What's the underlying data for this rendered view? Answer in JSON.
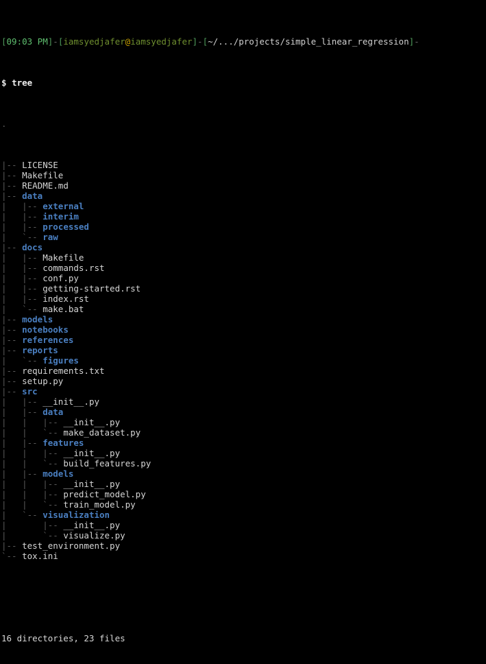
{
  "terminal": {
    "prompt": {
      "open_bracket": "[",
      "time": "09:03 PM",
      "close_bracket": "]",
      "dash1": "-",
      "user_open": "[",
      "user": "iamsyedjafer",
      "at": "@",
      "host": "iamsyedjafer",
      "user_close": "]",
      "dash2": "-",
      "path_open": "[",
      "path": "~/.../projects/simple_linear_regression",
      "path_close": "]",
      "dash3": "-",
      "dollar": "$",
      "command": "tree"
    },
    "tree": {
      "root": ".",
      "entries": [
        {
          "connector": "|-- ",
          "name": "LICENSE",
          "type": "file"
        },
        {
          "connector": "|-- ",
          "name": "Makefile",
          "type": "file"
        },
        {
          "connector": "|-- ",
          "name": "README.md",
          "type": "file"
        },
        {
          "connector": "|-- ",
          "name": "data",
          "type": "dir"
        },
        {
          "connector": "|   |-- ",
          "name": "external",
          "type": "dir"
        },
        {
          "connector": "|   |-- ",
          "name": "interim",
          "type": "dir"
        },
        {
          "connector": "|   |-- ",
          "name": "processed",
          "type": "dir"
        },
        {
          "connector": "|   `-- ",
          "name": "raw",
          "type": "dir"
        },
        {
          "connector": "|-- ",
          "name": "docs",
          "type": "dir"
        },
        {
          "connector": "|   |-- ",
          "name": "Makefile",
          "type": "file"
        },
        {
          "connector": "|   |-- ",
          "name": "commands.rst",
          "type": "file"
        },
        {
          "connector": "|   |-- ",
          "name": "conf.py",
          "type": "file"
        },
        {
          "connector": "|   |-- ",
          "name": "getting-started.rst",
          "type": "file"
        },
        {
          "connector": "|   |-- ",
          "name": "index.rst",
          "type": "file"
        },
        {
          "connector": "|   `-- ",
          "name": "make.bat",
          "type": "file"
        },
        {
          "connector": "|-- ",
          "name": "models",
          "type": "dir"
        },
        {
          "connector": "|-- ",
          "name": "notebooks",
          "type": "dir"
        },
        {
          "connector": "|-- ",
          "name": "references",
          "type": "dir"
        },
        {
          "connector": "|-- ",
          "name": "reports",
          "type": "dir"
        },
        {
          "connector": "|   `-- ",
          "name": "figures",
          "type": "dir"
        },
        {
          "connector": "|-- ",
          "name": "requirements.txt",
          "type": "file"
        },
        {
          "connector": "|-- ",
          "name": "setup.py",
          "type": "file"
        },
        {
          "connector": "|-- ",
          "name": "src",
          "type": "dir"
        },
        {
          "connector": "|   |-- ",
          "name": "__init__.py",
          "type": "file"
        },
        {
          "connector": "|   |-- ",
          "name": "data",
          "type": "dir"
        },
        {
          "connector": "|   |   |-- ",
          "name": "__init__.py",
          "type": "file"
        },
        {
          "connector": "|   |   `-- ",
          "name": "make_dataset.py",
          "type": "file"
        },
        {
          "connector": "|   |-- ",
          "name": "features",
          "type": "dir"
        },
        {
          "connector": "|   |   |-- ",
          "name": "__init__.py",
          "type": "file"
        },
        {
          "connector": "|   |   `-- ",
          "name": "build_features.py",
          "type": "file"
        },
        {
          "connector": "|   |-- ",
          "name": "models",
          "type": "dir"
        },
        {
          "connector": "|   |   |-- ",
          "name": "__init__.py",
          "type": "file"
        },
        {
          "connector": "|   |   |-- ",
          "name": "predict_model.py",
          "type": "file"
        },
        {
          "connector": "|   |   `-- ",
          "name": "train_model.py",
          "type": "file"
        },
        {
          "connector": "|   `-- ",
          "name": "visualization",
          "type": "dir"
        },
        {
          "connector": "|       |-- ",
          "name": "__init__.py",
          "type": "file"
        },
        {
          "connector": "|       `-- ",
          "name": "visualize.py",
          "type": "file"
        },
        {
          "connector": "|-- ",
          "name": "test_environment.py",
          "type": "file"
        },
        {
          "connector": "`-- ",
          "name": "tox.ini",
          "type": "file"
        }
      ],
      "summary": "16 directories, 23 files"
    }
  }
}
